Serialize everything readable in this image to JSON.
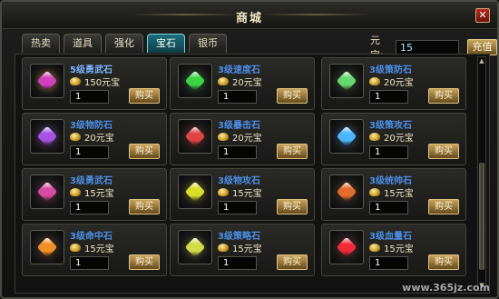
{
  "window": {
    "title": "商城"
  },
  "tabs": [
    {
      "label": "热卖",
      "active": false
    },
    {
      "label": "道具",
      "active": false
    },
    {
      "label": "强化",
      "active": false
    },
    {
      "label": "宝石",
      "active": true
    },
    {
      "label": "银币",
      "active": false
    }
  ],
  "currency": {
    "label": "元宝:",
    "value": "15",
    "recharge_label": "充值"
  },
  "items": [
    {
      "name": "5级勇武石",
      "price": "150元宝",
      "qty": "1",
      "buy_label": "购买",
      "gem_color": "#d23fbf",
      "glow_color": "#ffbf2a",
      "name_color": "#7db3ff",
      "icon": "purple-gem-icon"
    },
    {
      "name": "3级速度石",
      "price": "20元宝",
      "qty": "1",
      "buy_label": "购买",
      "gem_color": "#3bd443",
      "glow_color": "#2b8d33",
      "name_color": "#4d8fe8",
      "icon": "green-gem-icon"
    },
    {
      "name": "3级策防石",
      "price": "20元宝",
      "qty": "1",
      "buy_label": "购买",
      "gem_color": "#65d86d",
      "glow_color": "#2f6b2f",
      "name_color": "#4d8fe8",
      "icon": "green-crescent-gem-icon"
    },
    {
      "name": "3级物防石",
      "price": "20元宝",
      "qty": "1",
      "buy_label": "购买",
      "gem_color": "#a752e5",
      "glow_color": "#7e48c5",
      "name_color": "#4d8fe8",
      "icon": "violet-crystal-icon"
    },
    {
      "name": "3级暴击石",
      "price": "20元宝",
      "qty": "1",
      "buy_label": "购买",
      "gem_color": "#e04545",
      "glow_color": "#a62727",
      "name_color": "#4d8fe8",
      "icon": "red-orb-icon"
    },
    {
      "name": "3级策攻石",
      "price": "20元宝",
      "qty": "1",
      "buy_label": "购买",
      "gem_color": "#4bb7ff",
      "glow_color": "#2a74b5",
      "name_color": "#4d8fe8",
      "icon": "blue-gem-icon"
    },
    {
      "name": "3级勇武石",
      "price": "15元宝",
      "qty": "1",
      "buy_label": "购买",
      "gem_color": "#d94aa3",
      "glow_color": "#8b2d6a",
      "name_color": "#4d8fe8",
      "icon": "pink-gem-icon"
    },
    {
      "name": "3级物攻石",
      "price": "15元宝",
      "qty": "1",
      "buy_label": "购买",
      "gem_color": "#d8de26",
      "glow_color": "#b9a315",
      "name_color": "#4d8fe8",
      "icon": "yellow-green-gem-icon"
    },
    {
      "name": "3级统帅石",
      "price": "15元宝",
      "qty": "1",
      "buy_label": "购买",
      "gem_color": "#e36b2b",
      "glow_color": "#8a3b16",
      "name_color": "#4d8fe8",
      "icon": "orange-shard-icon"
    },
    {
      "name": "3级命中石",
      "price": "15元宝",
      "qty": "1",
      "buy_label": "购买",
      "gem_color": "#f08f25",
      "glow_color": "#884a12",
      "name_color": "#4d8fe8",
      "icon": "amber-gem-icon"
    },
    {
      "name": "3级策略石",
      "price": "15元宝",
      "qty": "1",
      "buy_label": "购买",
      "gem_color": "#cfdc45",
      "glow_color": "#8a8d24",
      "name_color": "#4d8fe8",
      "icon": "olive-crystal-icon"
    },
    {
      "name": "3级血量石",
      "price": "15元宝",
      "qty": "1",
      "buy_label": "购买",
      "gem_color": "#f12b38",
      "glow_color": "#a21d26",
      "name_color": "#4d8fe8",
      "icon": "ruby-gem-icon"
    }
  ],
  "watermark": "www.365jz.com"
}
